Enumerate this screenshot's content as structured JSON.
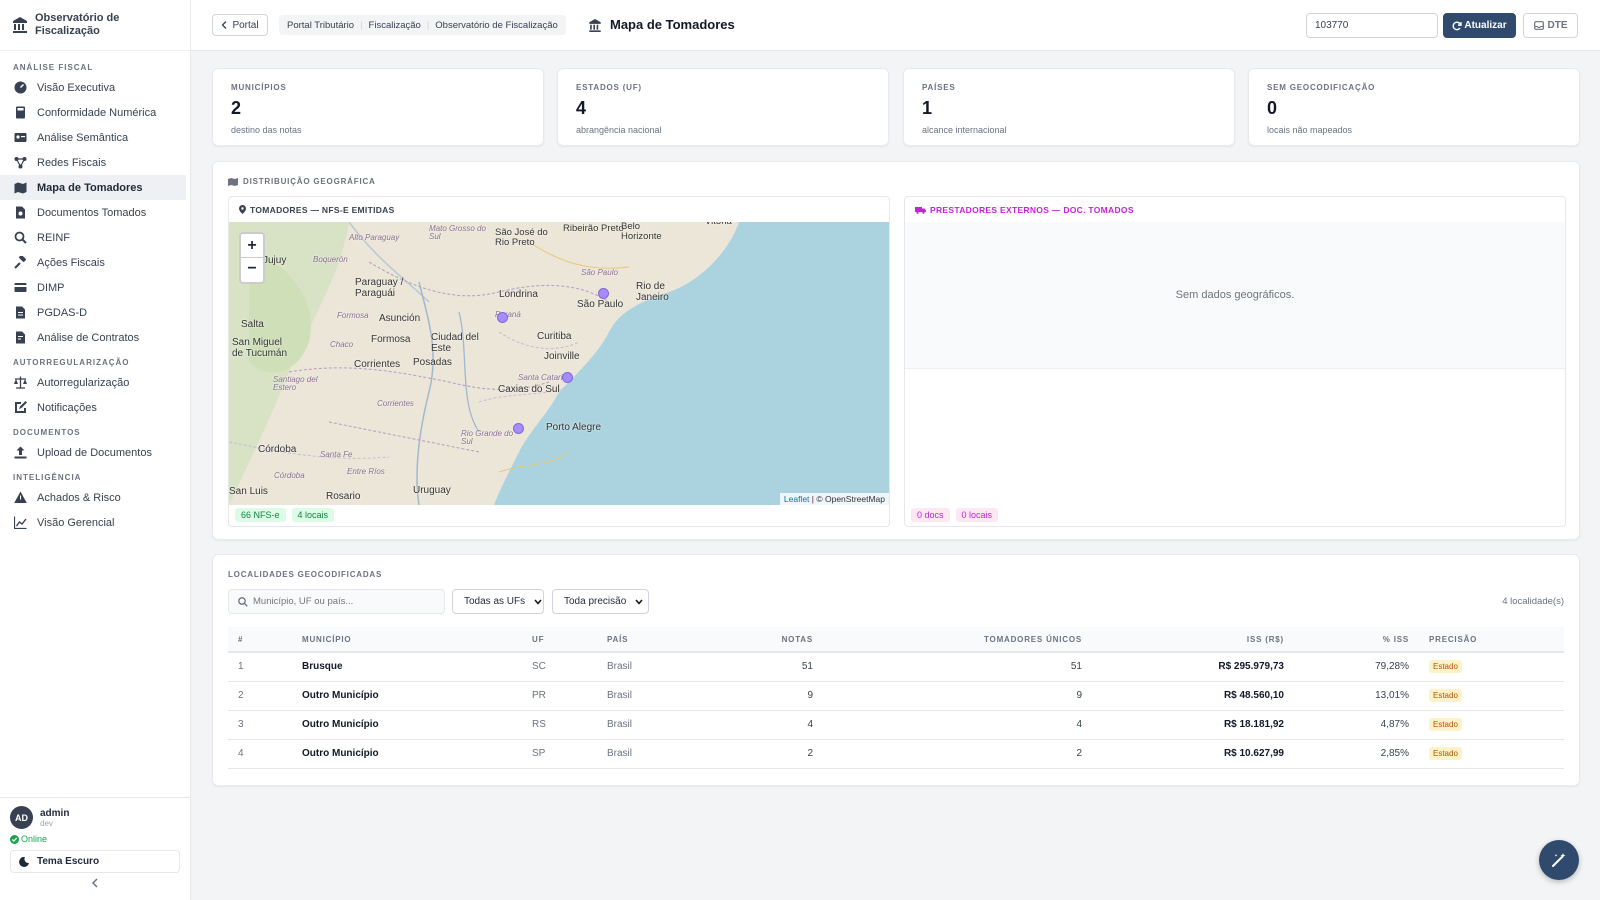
{
  "sidebar": {
    "brand": "Observatório de Fiscalização",
    "sections": [
      {
        "title": "ANÁLISE FISCAL",
        "items": [
          {
            "label": "Visão Executiva",
            "icon": "gauge-icon"
          },
          {
            "label": "Conformidade Numérica",
            "icon": "calculator-icon"
          },
          {
            "label": "Análise Semântica",
            "icon": "id-card-icon"
          },
          {
            "label": "Redes Fiscais",
            "icon": "network-icon"
          },
          {
            "label": "Mapa de Tomadores",
            "icon": "map-icon",
            "active": true
          },
          {
            "label": "Documentos Tomados",
            "icon": "document-icon"
          },
          {
            "label": "REINF",
            "icon": "search-icon"
          },
          {
            "label": "Ações Fiscais",
            "icon": "gavel-icon"
          },
          {
            "label": "DIMP",
            "icon": "card-icon"
          },
          {
            "label": "PGDAS-D",
            "icon": "file-icon"
          },
          {
            "label": "Análise de Contratos",
            "icon": "contract-icon"
          }
        ]
      },
      {
        "title": "AUTORREGULARIZAÇÃO",
        "items": [
          {
            "label": "Autorregularização",
            "icon": "scale-icon"
          },
          {
            "label": "Notificações",
            "icon": "edit-icon"
          }
        ]
      },
      {
        "title": "DOCUMENTOS",
        "items": [
          {
            "label": "Upload de Documentos",
            "icon": "upload-icon"
          }
        ]
      },
      {
        "title": "INTELIGÊNCIA",
        "items": [
          {
            "label": "Achados & Risco",
            "icon": "warning-icon"
          },
          {
            "label": "Visão Gerencial",
            "icon": "chart-line-icon"
          }
        ]
      }
    ],
    "user": {
      "initials": "AD",
      "name": "admin",
      "role": "dev",
      "status": "Online",
      "theme_button": "Tema Escuro"
    }
  },
  "topbar": {
    "portal_button": "Portal",
    "breadcrumb": [
      "Portal Tributário",
      "Fiscalização",
      "Observatório de Fiscalização"
    ],
    "page_title": "Mapa de Tomadores",
    "search_value": "103770",
    "refresh_button": "Atualizar",
    "dte_button": "DTE"
  },
  "kpis": [
    {
      "label": "MUNICÍPIOS",
      "value": "2",
      "sub": "destino das notas"
    },
    {
      "label": "ESTADOS (UF)",
      "value": "4",
      "sub": "abrangência nacional"
    },
    {
      "label": "PAÍSES",
      "value": "1",
      "sub": "alcance internacional"
    },
    {
      "label": "SEM GEOCODIFICAÇÃO",
      "value": "0",
      "sub": "locais não mapeados"
    }
  ],
  "geo": {
    "title": "DISTRIBUIÇÃO GEOGRÁFICA",
    "left_title": "TOMADORES — NFS-E EMITIDAS",
    "left_pills": [
      "66 NFS-e",
      "4 locais"
    ],
    "attribution_leaflet": "Leaflet",
    "attribution_osm": "| © OpenStreetMap",
    "zoom_in": "+",
    "zoom_out": "−",
    "right_title": "PRESTADORES EXTERNOS — DOC. TOMADOS",
    "right_empty": "Sem dados geográficos.",
    "right_pills": [
      "0 docs",
      "0 locais"
    ],
    "map_labels": [
      "Mato Grosso do Sul",
      "São José do Rio Preto",
      "Ribeirão Preto",
      "Belo Horizonte",
      "Vitória",
      "Alto Paraguay",
      "Boquerón",
      "Paraguay / Paraguái",
      "São Paulo",
      "Rio de Janeiro",
      "Londrina",
      "São Paulo",
      "Paraná",
      "Formosa",
      "Asunción",
      "Salta",
      "Chaco",
      "Formosa",
      "Ciudad del Este",
      "Curitiba",
      "San Miguel de Tucumán",
      "Corrientes",
      "Posadas",
      "Joinville",
      "Santiago del Estero",
      "Santa Catarina",
      "Caxias do Sul",
      "Corrientes",
      "Rio Grande do Sul",
      "Porto Alegre",
      "Córdoba",
      "Santa Fe",
      "Entre Ríos",
      "Córdoba",
      "Uruguay",
      "Rosario",
      "San Luis",
      "Jujuy"
    ]
  },
  "table": {
    "title": "LOCALIDADES GEOCODIFICADAS",
    "search_placeholder": "Município, UF ou país...",
    "uf_select": "Todas as UFs",
    "precision_select": "Toda precisão",
    "count": "4 localidade(s)",
    "headers": [
      "#",
      "MUNICÍPIO",
      "UF",
      "PAÍS",
      "NOTAS",
      "TOMADORES ÚNICOS",
      "ISS (R$)",
      "% ISS",
      "PRECISÃO"
    ],
    "rows": [
      [
        "1",
        "Brusque",
        "SC",
        "Brasil",
        "51",
        "51",
        "R$ 295.979,73",
        "79,28%",
        "Estado"
      ],
      [
        "2",
        "Outro Município",
        "PR",
        "Brasil",
        "9",
        "9",
        "R$ 48.560,10",
        "13,01%",
        "Estado"
      ],
      [
        "3",
        "Outro Município",
        "RS",
        "Brasil",
        "4",
        "4",
        "R$ 18.181,92",
        "4,87%",
        "Estado"
      ],
      [
        "4",
        "Outro Município",
        "SP",
        "Brasil",
        "2",
        "2",
        "R$ 10.627,99",
        "2,85%",
        "Estado"
      ]
    ]
  },
  "colors": {
    "accent": "#2f4a6d",
    "marker": "#a78bfa",
    "green_pill": "#dcfce7",
    "pink_pill": "#fce7f3",
    "sea": "#aad3df",
    "land": "#f2efe9"
  }
}
